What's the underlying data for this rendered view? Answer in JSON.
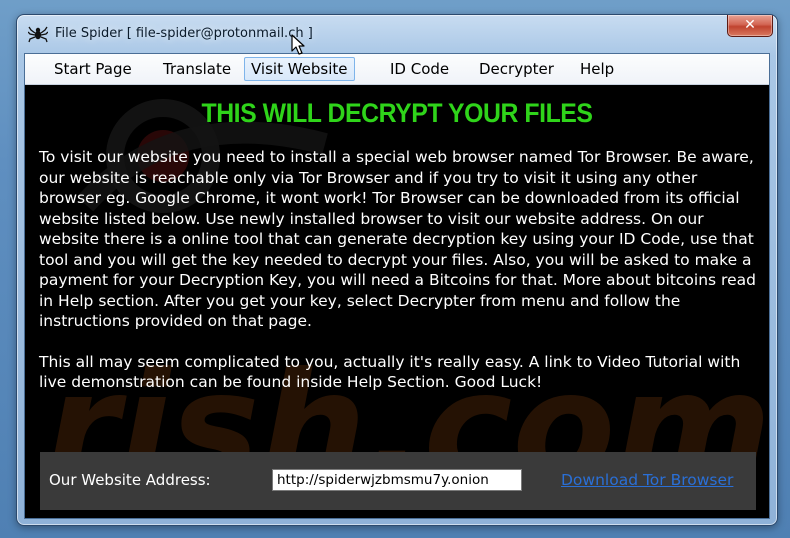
{
  "window": {
    "title": "File Spider [ file-spider@protonmail.ch ]",
    "close_label": "✕"
  },
  "menu": {
    "items": [
      {
        "label": "Start Page"
      },
      {
        "label": "Translate"
      },
      {
        "label": "Visit Website",
        "hovered": true
      },
      {
        "label": "ID Code"
      },
      {
        "label": "Decrypter"
      },
      {
        "label": "Help"
      }
    ]
  },
  "content": {
    "headline": "THIS WILL DECRYPT YOUR FILES",
    "paragraphs": [
      "To visit our website you need to install a special web browser named Tor Browser. Be aware, our website is reachable only via Tor Browser and if you try to visit it using any other browser eg. Google Chrome, it wont work! Tor Browser can be downloaded from its official website listed below. Use newly installed browser to visit our website address. On our website there is a online tool that can generate decryption key using your ID Code, use that tool and you will get the key needed to decrypt your files. Also, you will be asked to make a payment for your Decryption Key, you will need a Bitcoins for that. More about bitcoins read in Help section. After you get your key, select Decrypter from menu and follow the instructions provided on that page.",
      "This all may seem complicated to you, actually it's really easy. A link to Video Tutorial with live demonstration can be found inside Help Section. Good Luck!"
    ]
  },
  "address": {
    "label": "Our Website Address:",
    "value": "http://spiderwjzbmsmu7y.onion",
    "download_link": "Download Tor Browser"
  },
  "watermark": {
    "text": "rish.com"
  },
  "colors": {
    "headline": "#2fd41a",
    "background": "#000000",
    "link": "#2a6fd6",
    "address_panel": "#3a3a3a"
  },
  "icons": {
    "window": "spider-icon",
    "close": "close-icon",
    "cursor": "mouse-cursor-icon"
  }
}
